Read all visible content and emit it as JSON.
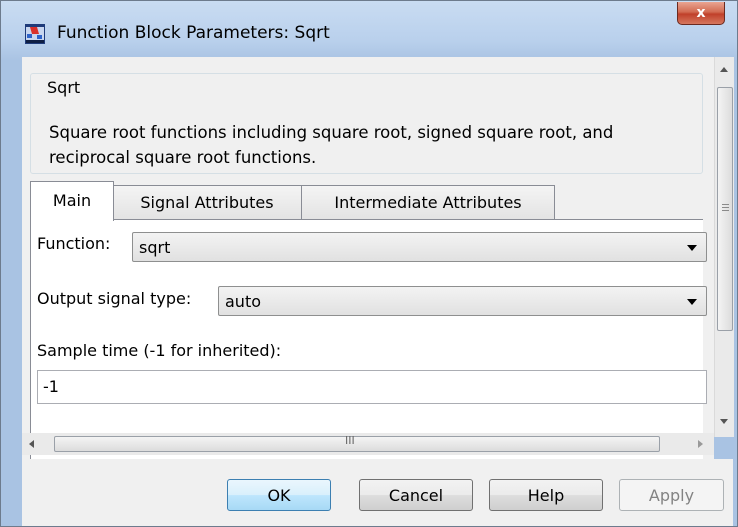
{
  "window": {
    "title": "Function Block Parameters: Sqrt",
    "close_label": "x"
  },
  "block": {
    "name": "Sqrt",
    "description": "Square root functions including square root, signed square root, and reciprocal square root functions."
  },
  "tabs": [
    {
      "label": "Main",
      "active": true
    },
    {
      "label": "Signal Attributes",
      "active": false
    },
    {
      "label": "Intermediate Attributes",
      "active": false
    }
  ],
  "main": {
    "function_label": "Function:",
    "function_value": "sqrt",
    "output_type_label": "Output signal type:",
    "output_type_value": "auto",
    "sample_time_label": "Sample time (-1 for inherited):",
    "sample_time_value": "-1"
  },
  "buttons": {
    "ok": "OK",
    "cancel": "Cancel",
    "help": "Help",
    "apply": "Apply"
  },
  "hscroll_grip": "III",
  "colors": {
    "titlebar": "#b9d0ec",
    "close_button": "#c0402a",
    "default_button_border": "#3c7fb1"
  }
}
